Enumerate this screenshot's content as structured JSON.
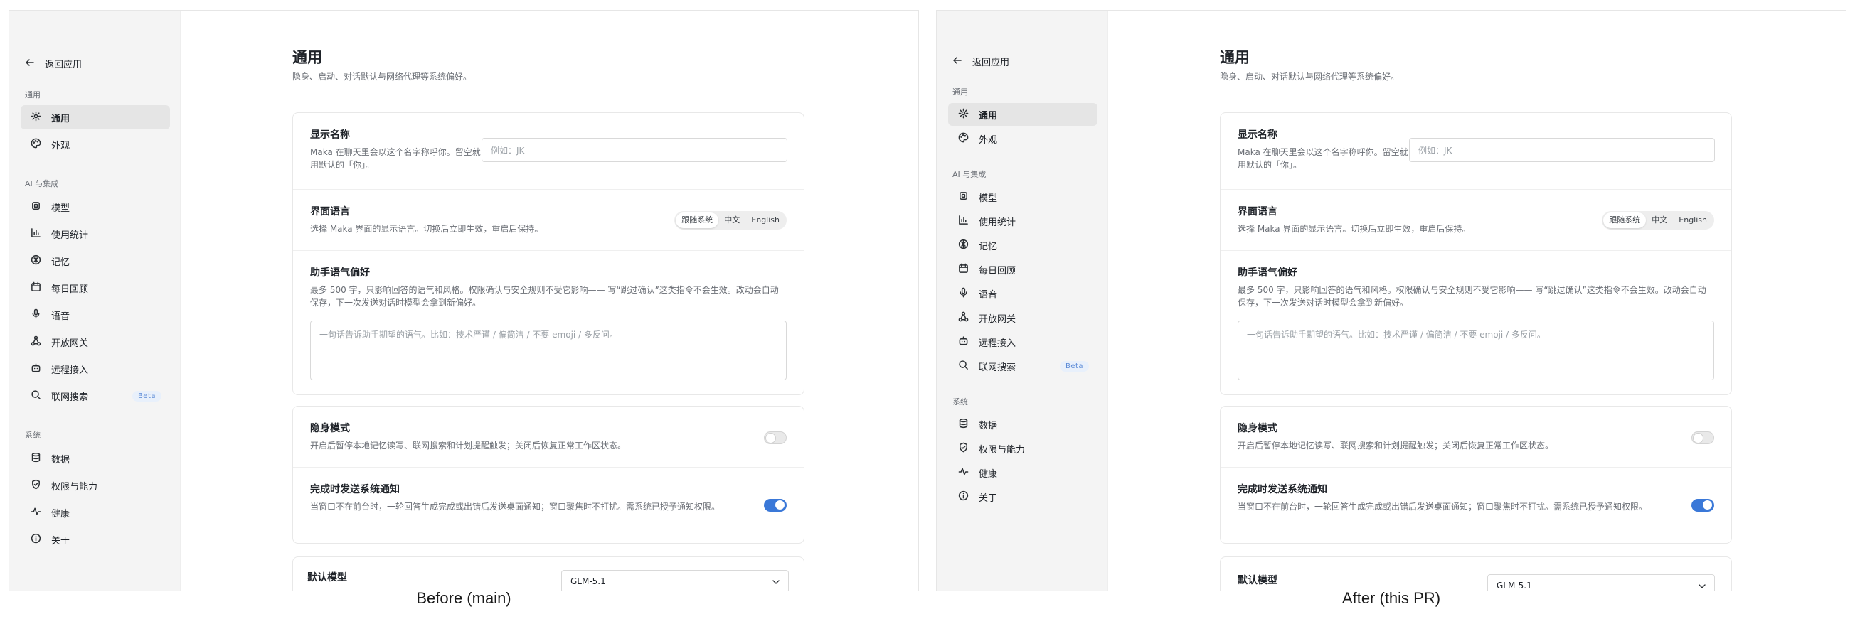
{
  "captions": {
    "before": "Before (main)",
    "after": "After (this PR)"
  },
  "sidebar": {
    "back_label": "返回应用",
    "sections": [
      {
        "label": "通用",
        "items": [
          {
            "label": "通用",
            "icon": "gear-icon",
            "active": true
          },
          {
            "label": "外观",
            "icon": "palette-icon"
          }
        ]
      },
      {
        "label": "AI 与集成",
        "items": [
          {
            "label": "模型",
            "icon": "chip-icon"
          },
          {
            "label": "使用统计",
            "icon": "bar-chart-icon"
          },
          {
            "label": "记忆",
            "icon": "brain-icon"
          },
          {
            "label": "每日回顾",
            "icon": "calendar-icon"
          },
          {
            "label": "语音",
            "icon": "microphone-icon"
          },
          {
            "label": "开放网关",
            "icon": "network-icon"
          },
          {
            "label": "远程接入",
            "icon": "bot-icon"
          },
          {
            "label": "联网搜索",
            "icon": "search-icon",
            "badge": "Beta"
          }
        ]
      },
      {
        "label": "系统",
        "items": [
          {
            "label": "数据",
            "icon": "database-icon"
          },
          {
            "label": "权限与能力",
            "icon": "shield-icon"
          },
          {
            "label": "健康",
            "icon": "pulse-icon"
          },
          {
            "label": "关于",
            "icon": "info-icon"
          }
        ]
      }
    ]
  },
  "main": {
    "title": "通用",
    "subtitle": "隐身、启动、对话默认与网络代理等系统偏好。",
    "display_name": {
      "title": "显示名称",
      "desc": "Maka 在聊天里会以这个名字称呼你。留空就用默认的「你」。",
      "placeholder": "例如：JK"
    },
    "ui_language": {
      "title": "界面语言",
      "desc": "选择 Maka 界面的显示语言。切换后立即生效，重启后保持。",
      "options": [
        "跟随系统",
        "中文",
        "English"
      ],
      "selected": "跟随系统"
    },
    "tone": {
      "title": "助手语气偏好",
      "desc": "最多 500 字，只影响回答的语气和风格。权限确认与安全规则不受它影响—— 写“跳过确认”这类指令不会生效。改动会自动保存，下一次发送对话时模型会拿到新偏好。",
      "placeholder": "一句话告诉助手期望的语气。比如：技术严谨 / 偏简洁 / 不要 emoji / 多反问。"
    },
    "stealth": {
      "title": "隐身模式",
      "desc": "开启后暂停本地记忆读写、联网搜索和计划提醒触发；关闭后恢复正常工作区状态。",
      "enabled": false
    },
    "notify": {
      "title": "完成时发送系统通知",
      "desc": "当窗口不在前台时，一轮回答生成完成或出错后发送桌面通知；窗口聚焦时不打扰。需系统已授予通知权限。",
      "enabled": true
    },
    "default_model": {
      "title": "默认模型",
      "value": "GLM-5.1"
    }
  },
  "colors": {
    "accent": "#3a78d8",
    "badge_bg": "#e8f0fb",
    "badge_text": "#5b8ad6"
  }
}
